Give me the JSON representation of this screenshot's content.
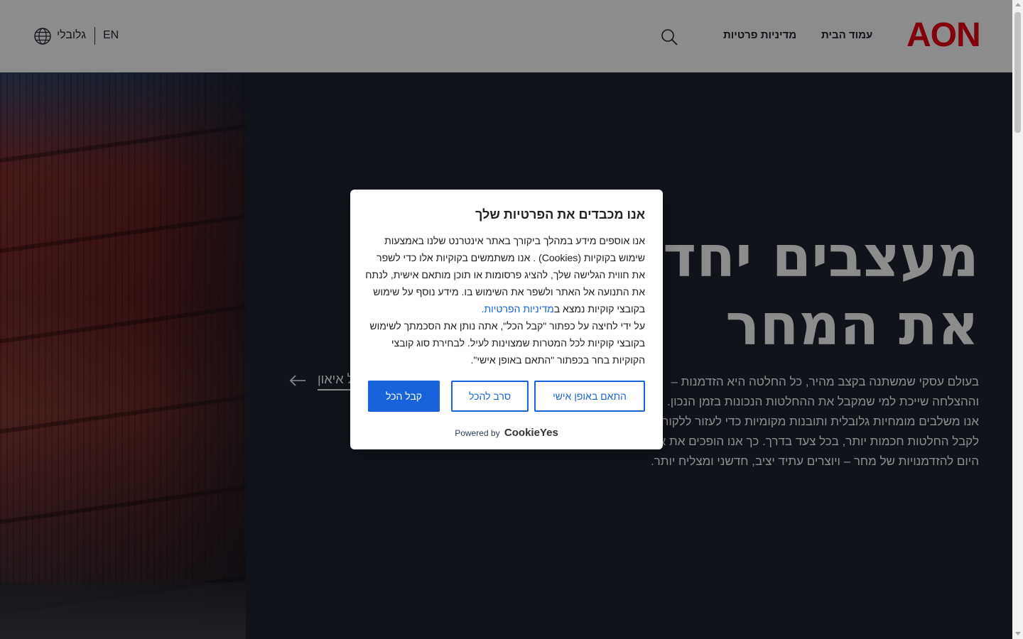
{
  "header": {
    "logo": "AON",
    "nav": {
      "home": "עמוד הבית",
      "privacy": "מדיניות פרטיות"
    },
    "search_icon": "search-icon",
    "lang": {
      "en": "EN",
      "global": "גלובלי",
      "icon": "globe-icon"
    }
  },
  "hero": {
    "title_line1": "מעצבים יחד",
    "title_line2": "את המחר",
    "text_lines": [
      "בעולם עסקי שמשתנה בקצב מהיר, כל החלטה היא הזדמנות –",
      "וההצלחה שייכת למי שמקבל את ההחלטות הנכונות בזמן הנכון.",
      "אנו משלבים מומחיות גלובלית ותובנות מקומיות כדי לעזור ללקוחותינו",
      "לקבל החלטות חכמות יותר, בכל צעד בדרך. כך אנו הופכים את אתגרי",
      "היום להזדמנויות של מחר – ויוצרים עתיד יציב, חדשני ומצליח יותר."
    ],
    "link_label": "על איאון",
    "arrow_icon": "arrow-left-icon"
  },
  "cookie_modal": {
    "title": "אנו מכבדים את הפרטיות שלך",
    "body_part1": "אנו אוספים מידע במהלך ביקורך באתר אינטרנט שלנו באמצעות שימוש בקוקיות (Cookies) . אנו משתמשים בקוקיות אלו כדי לשפר את חווית הגלישה שלך, להציג פרסומות או תוכן מותאם אישית, לנתח את התנועה אל האתר ולשפר את השימוש בו. מידע נוסף על שימוש בקובצי קוקיות נמצא ב",
    "policy_link": "מדיניות הפרטיות.",
    "body_part2": "על ידי לחיצה על כפתור \"קבל הכל\", אתה נותן את הסכמתך לשימוש בקובצי קוקיות לכל המטרות שמצוינות לעיל. לבחירת סוג קובצי הקוקיות בחר בכפתור \"התאם באופן אישי\".",
    "btn_customize": "התאם באופן אישי",
    "btn_reject": "סרב להכל",
    "btn_accept": "קבל הכל",
    "powered_by": "Powered by",
    "powered_brand": "CookieYes"
  },
  "colors": {
    "brand_red": "#eb0017",
    "cookie_blue": "#1863dc",
    "hero_bg": "#1e2330"
  }
}
